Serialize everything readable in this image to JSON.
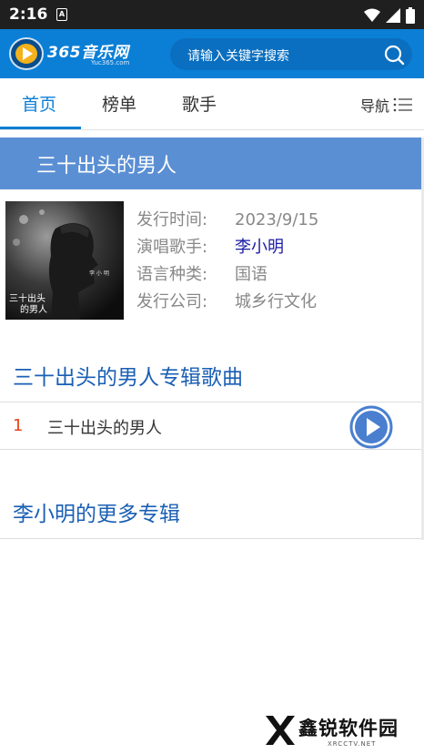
{
  "status_bar": {
    "time": "2:16",
    "sim_label": "A"
  },
  "header": {
    "logo_text": "365音乐网",
    "logo_sub": "Yuc365.com",
    "search_placeholder": "请输入关键字搜索"
  },
  "tabs": [
    {
      "label": "首页",
      "active": true
    },
    {
      "label": "榜单",
      "active": false
    },
    {
      "label": "歌手",
      "active": false
    }
  ],
  "nav_label": "导航",
  "album": {
    "title": "三十出头的男人",
    "cover_text_1": "三十出头",
    "cover_text_2": "的男人",
    "cover_artist": "李 小 明",
    "info": [
      {
        "label": "发行时间:",
        "value": "2023/9/15",
        "link": false
      },
      {
        "label": "演唱歌手:",
        "value": "李小明",
        "link": true
      },
      {
        "label": "语言种类:",
        "value": "国语",
        "link": false
      },
      {
        "label": "发行公司:",
        "value": "城乡行文化",
        "link": false
      }
    ]
  },
  "songs_section_title": "三十出头的男人专辑歌曲",
  "songs": [
    {
      "num": "1",
      "name": "三十出头的男人"
    }
  ],
  "more_section_title": "李小明的更多专辑",
  "watermark": {
    "text": "鑫锐软件园",
    "sub": "XRCCTV.NET"
  },
  "colors": {
    "primary": "#0b7fd6",
    "title_band": "#5b8fd4",
    "link": "#1a1aa6",
    "song_num": "#e8431b"
  }
}
